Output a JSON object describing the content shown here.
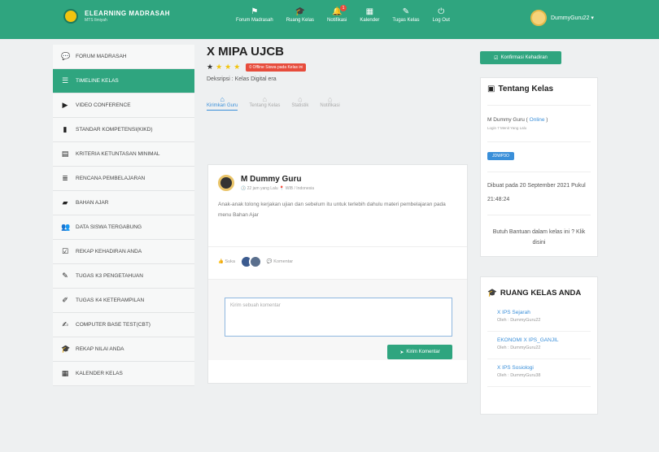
{
  "brand": {
    "name": "ELEARNING MADRASAH",
    "sub": "MTS Ilmiyah"
  },
  "nav": [
    {
      "label": "Forum Madrasah",
      "icon": "comments-icon",
      "glyph": "⚑"
    },
    {
      "label": "Ruang Kelas",
      "icon": "graduation-cap-icon",
      "glyph": "🎓"
    },
    {
      "label": "Notifikasi",
      "icon": "bell-icon",
      "glyph": "🔔",
      "badge": "1"
    },
    {
      "label": "Kalender",
      "icon": "calendar-icon",
      "glyph": "▦"
    },
    {
      "label": "Tugas Kelas",
      "icon": "tasks-icon",
      "glyph": "✎"
    },
    {
      "label": "Log Out",
      "icon": "logout-icon",
      "glyph": "⏻"
    }
  ],
  "user": {
    "name": "DummyGuru22 ▾"
  },
  "sidebar": [
    {
      "label": "Forum Madrasah",
      "icon": "comments-icon",
      "glyph": "💬"
    },
    {
      "label": "Timeline Kelas",
      "icon": "timeline-icon",
      "glyph": "☰",
      "active": true
    },
    {
      "label": "Video Conference",
      "icon": "video-icon",
      "glyph": "▶"
    },
    {
      "label": "Standar Kompetensi(KIKD)",
      "icon": "book-icon",
      "glyph": "▮"
    },
    {
      "label": "Kriteria Ketuntasan Minimal",
      "icon": "chart-icon",
      "glyph": "▤"
    },
    {
      "label": "Rencana Pembelajaran",
      "icon": "list-icon",
      "glyph": "≣"
    },
    {
      "label": "Bahan Ajar",
      "icon": "folder-icon",
      "glyph": "▰"
    },
    {
      "label": "Data Siswa Tergabung",
      "icon": "users-icon",
      "glyph": "👥"
    },
    {
      "label": "Rekap Kehadiran Anda",
      "icon": "check-square-icon",
      "glyph": "☑"
    },
    {
      "label": "Tugas K3 Pengetahuan",
      "icon": "pencil-icon",
      "glyph": "✎"
    },
    {
      "label": "Tugas K4 Keterampilan",
      "icon": "brush-icon",
      "glyph": "✐"
    },
    {
      "label": "Computer Base Test(CBT)",
      "icon": "edit-icon",
      "glyph": "✍"
    },
    {
      "label": "Rekap Nilai Anda",
      "icon": "graduation-cap-icon",
      "glyph": "🎓"
    },
    {
      "label": "Kalender Kelas",
      "icon": "calendar-icon",
      "glyph": "▦"
    }
  ],
  "class": {
    "title": "X MIPA UJCB",
    "offline_badge": "0 Offline Siswa pada Kelas ini",
    "description": "Deksripsi : Kelas Digital era"
  },
  "tabs": [
    {
      "label": "Kirimkan Guru",
      "active": true
    },
    {
      "label": "Tentang Kelas"
    },
    {
      "label": "Statistik"
    },
    {
      "label": "Notifikasi"
    }
  ],
  "post": {
    "author": "M Dummy Guru",
    "meta": "🕓 22 jam yang Lalu   📍 WIB / Indonesia",
    "body": "Anak-anak tolong kerjakan ujian dan sebelum itu untuk terlebih dahulu materi pembelajaran pada menu Bahan Ajar",
    "like_label": "👍 Suka",
    "comment_label": "💬 Komentar",
    "comment_placeholder": "Kirim sebuah komentar",
    "send_label": "Kirim Komentar"
  },
  "right": {
    "confirm_label": "Konfirmasi Kehadiran",
    "about_title": "Tentang Kelas",
    "teacher_prefix": "M Dummy Guru ( ",
    "teacher_status": "Online",
    "teacher_suffix": " )",
    "login_text": "Login 7 Menit Yang Lalu",
    "class_code": "JDWP3O",
    "created": "Dibuat pada 20 September 2021 Pukul 21:48:24",
    "help": "Butuh Bantuan dalam kelas ini ? Klik disini",
    "rooms_title": "RUANG KELAS ANDA",
    "rooms": [
      {
        "name": "X IPS Sejarah",
        "owner": "Oleh : DummyGuru22"
      },
      {
        "name": "EKONOMI X IPS_GANJIL",
        "owner": "Oleh : DummyGuru22"
      },
      {
        "name": "X IPS Sosiologi",
        "owner": "Oleh : DummyGuru38"
      }
    ]
  }
}
